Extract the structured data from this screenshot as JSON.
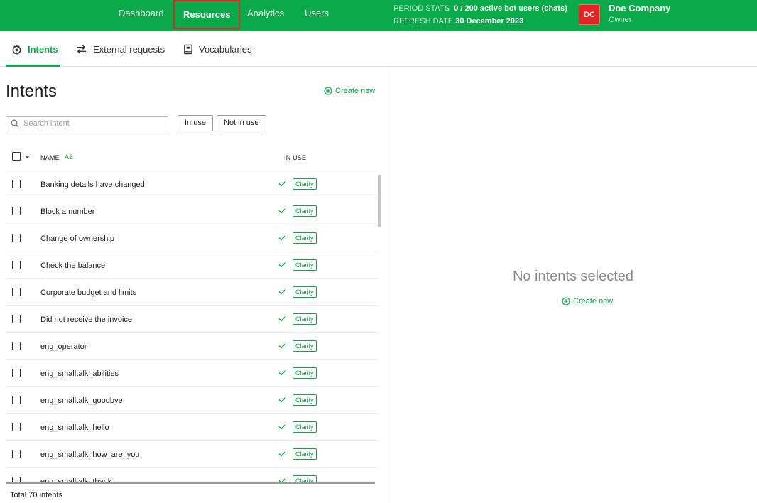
{
  "nav": {
    "items": [
      "Dashboard",
      "Resources",
      "Analytics",
      "Users"
    ],
    "active": "Resources"
  },
  "stats": {
    "period_label": "PERIOD STATS",
    "period_value": "0  / 200 active bot users (chats)",
    "refresh_label": "REFRESH DATE",
    "refresh_value": "30 December 2023"
  },
  "account": {
    "initials": "DC",
    "company": "Doe Company",
    "role": "Owner"
  },
  "tabs": [
    "Intents",
    "External requests",
    "Vocabularies"
  ],
  "intents_panel": {
    "title": "Intents",
    "create_new": "Create new",
    "search_placeholder": "Search intent",
    "filter_in_use": "In use",
    "filter_not_in_use": "Not in use",
    "col_name": "NAME",
    "col_in_use": "IN USE",
    "sort_glyph": "AZ",
    "rows": [
      {
        "name": "Banking details have changed",
        "tag": "Clarify"
      },
      {
        "name": "Block a number",
        "tag": "Clarify"
      },
      {
        "name": "Change of ownership",
        "tag": "Clarify"
      },
      {
        "name": "Check the balance",
        "tag": "Clarify"
      },
      {
        "name": "Corporate budget and limits",
        "tag": "Clarify"
      },
      {
        "name": "Did not receive the invoice",
        "tag": "Clarify"
      },
      {
        "name": "eng_operator",
        "tag": "Clarify"
      },
      {
        "name": "eng_smalltalk_abilities",
        "tag": "Clarify"
      },
      {
        "name": "eng_smalltalk_goodbye",
        "tag": "Clarify"
      },
      {
        "name": "eng_smalltalk_hello",
        "tag": "Clarify"
      },
      {
        "name": "eng_smalltalk_how_are_you",
        "tag": "Clarify"
      },
      {
        "name": "eng_smalltalk_thank",
        "tag": "Clarify"
      }
    ],
    "total": "Total 70 intents"
  },
  "detail_panel": {
    "empty_title": "No intents selected",
    "create_new": "Create new"
  },
  "colors": {
    "brand_green": "#0aaa4a",
    "highlight_red": "#d42b2b",
    "avatar_red": "#e62323"
  }
}
